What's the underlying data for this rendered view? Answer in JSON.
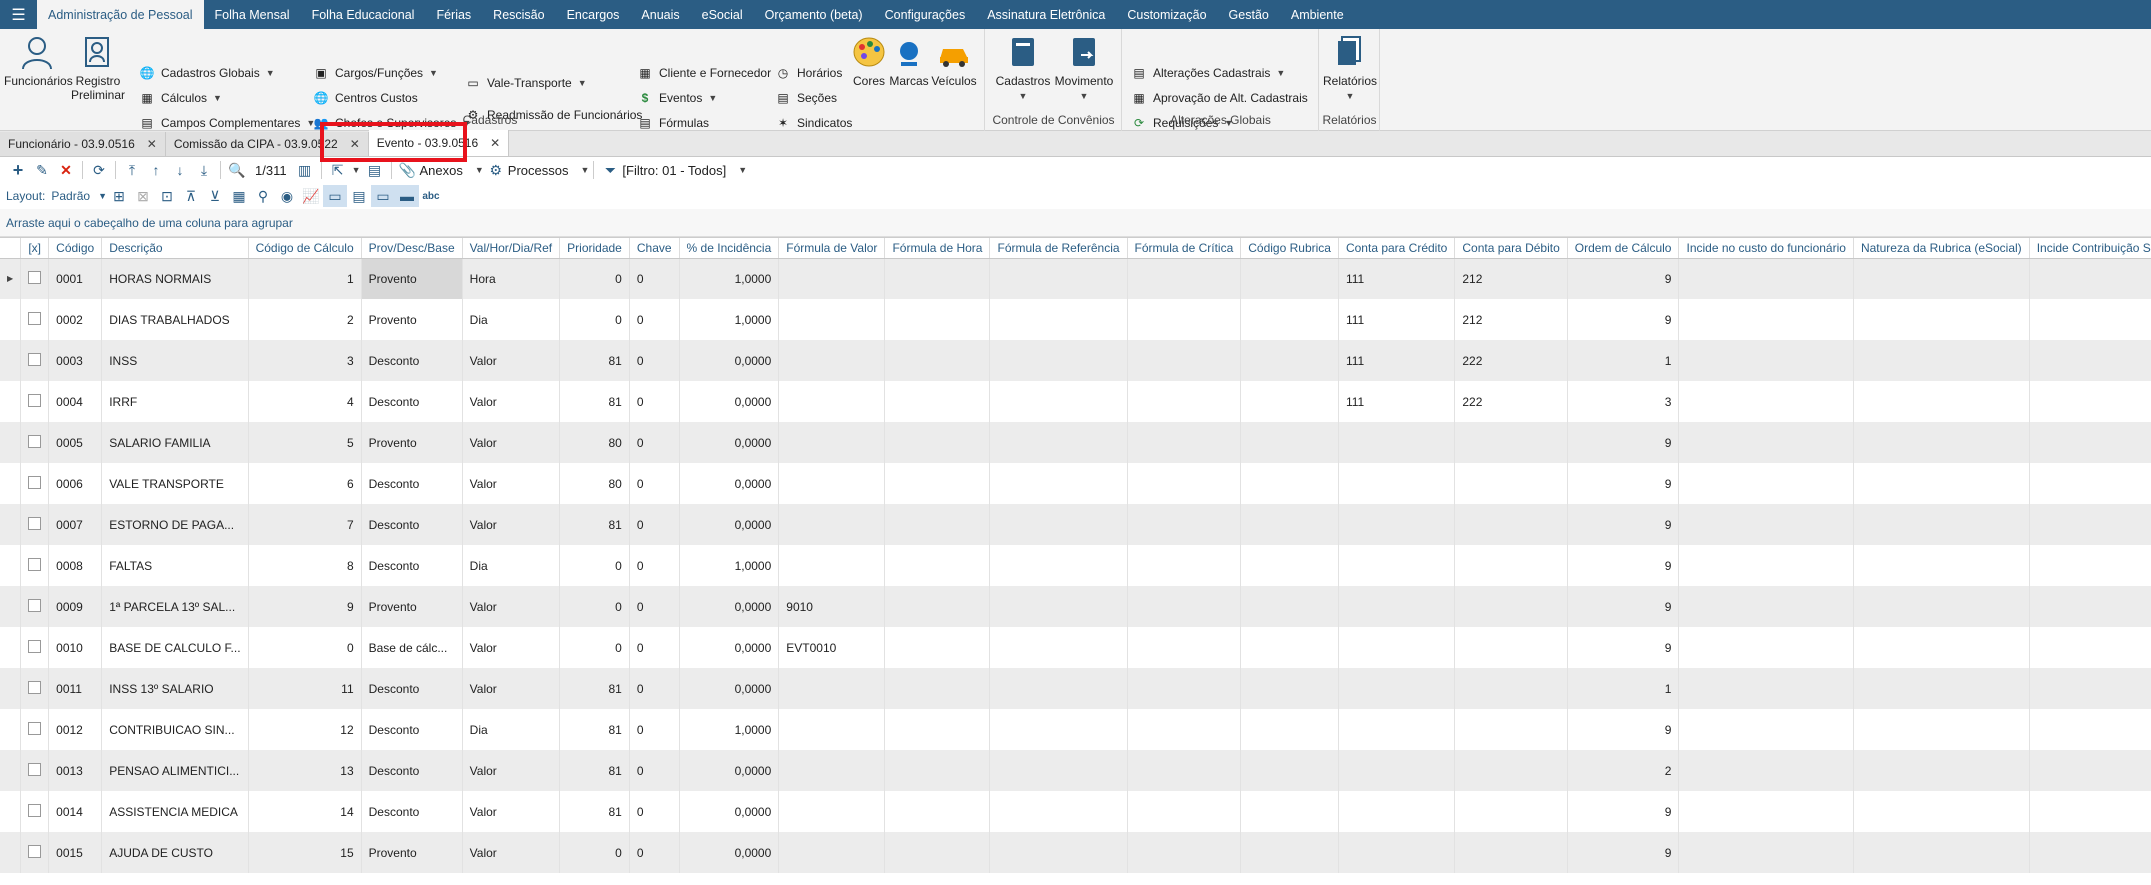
{
  "menu": {
    "items": [
      "Administração de Pessoal",
      "Folha Mensal",
      "Folha Educacional",
      "Férias",
      "Rescisão",
      "Encargos",
      "Anuais",
      "eSocial",
      "Orçamento (beta)",
      "Configurações",
      "Assinatura Eletrônica",
      "Customização",
      "Gestão",
      "Ambiente"
    ]
  },
  "ribbon": {
    "funcionarios": "Funcionários",
    "registro_l1": "Registro",
    "registro_l2": "Preliminar",
    "cadastros_globais": "Cadastros Globais",
    "calculos": "Cálculos",
    "campos_complementares": "Campos Complementares",
    "cargos_funcoes": "Cargos/Funções",
    "centros_custos": "Centros Custos",
    "chefes_supervisores": "Chefes e Supervisores",
    "vale_transporte": "Vale-Transporte",
    "readmissao": "Readmissão de Funcionários",
    "cliente_fornecedor": "Cliente e Fornecedor",
    "eventos": "Eventos",
    "formulas": "Fórmulas",
    "horarios": "Horários",
    "secoes": "Seções",
    "sindicatos": "Sindicatos",
    "cores": "Cores",
    "marcas": "Marcas",
    "veiculos": "Veículos",
    "group_cadastros": "Cadastros",
    "cadastros_btn": "Cadastros",
    "movimento_btn": "Movimento",
    "group_convenios": "Controle de Convênios",
    "alteracoes_cadastrais": "Alterações Cadastrais",
    "aprovacao": "Aprovação de Alt. Cadastrais",
    "requisicoes": "Requisições",
    "group_alteracoes": "Alterações Globais",
    "relatorios_btn": "Relatórios",
    "group_relatorios": "Relatórios"
  },
  "doctabs": [
    {
      "label": "Funcionário - 03.9.0516"
    },
    {
      "label": "Comissão da CIPA - 03.9.0522"
    },
    {
      "label": "Evento - 03.9.0516"
    }
  ],
  "toolbar": {
    "record_nav": "1/311",
    "anexos": "Anexos",
    "processos": "Processos",
    "filtro": "[Filtro: 01 - Todos]",
    "layout_label": "Layout:",
    "layout_value": "Padrão"
  },
  "grid": {
    "group_hint": "Arraste aqui o cabeçalho de uma coluna para agrupar",
    "columns": [
      "[x]",
      "Código",
      "Descrição",
      "Código de Cálculo",
      "Prov/Desc/Base",
      "Val/Hor/Dia/Ref",
      "Prioridade",
      "Chave",
      "% de Incidência",
      "Fórmula de Valor",
      "Fórmula de Hora",
      "Fórmula de Referência",
      "Fórmula de Crítica",
      "Código Rubrica",
      "Conta para Crédito",
      "Conta para Débito",
      "Ordem de Cálculo",
      "Incide no custo do funcionário",
      "Natureza da Rubrica (eSocial)",
      "Incide Contribuição Sindical"
    ],
    "rows": [
      [
        "0001",
        "HORAS NORMAIS",
        "1",
        "Provento",
        "Hora",
        "0",
        "0",
        "1,0000",
        "",
        "",
        "",
        "",
        "",
        "111",
        "212",
        "9"
      ],
      [
        "0002",
        "DIAS TRABALHADOS",
        "2",
        "Provento",
        "Dia",
        "0",
        "0",
        "1,0000",
        "",
        "",
        "",
        "",
        "",
        "111",
        "212",
        "9"
      ],
      [
        "0003",
        "INSS",
        "3",
        "Desconto",
        "Valor",
        "81",
        "0",
        "0,0000",
        "",
        "",
        "",
        "",
        "",
        "111",
        "222",
        "1"
      ],
      [
        "0004",
        "IRRF",
        "4",
        "Desconto",
        "Valor",
        "81",
        "0",
        "0,0000",
        "",
        "",
        "",
        "",
        "",
        "111",
        "222",
        "3"
      ],
      [
        "0005",
        "SALARIO FAMILIA",
        "5",
        "Provento",
        "Valor",
        "80",
        "0",
        "0,0000",
        "",
        "",
        "",
        "",
        "",
        "",
        "",
        "9"
      ],
      [
        "0006",
        "VALE TRANSPORTE",
        "6",
        "Desconto",
        "Valor",
        "80",
        "0",
        "0,0000",
        "",
        "",
        "",
        "",
        "",
        "",
        "",
        "9"
      ],
      [
        "0007",
        "ESTORNO DE PAGA...",
        "7",
        "Desconto",
        "Valor",
        "81",
        "0",
        "0,0000",
        "",
        "",
        "",
        "",
        "",
        "",
        "",
        "9"
      ],
      [
        "0008",
        "FALTAS",
        "8",
        "Desconto",
        "Dia",
        "0",
        "0",
        "1,0000",
        "",
        "",
        "",
        "",
        "",
        "",
        "",
        "9"
      ],
      [
        "0009",
        "1ª PARCELA 13º SAL...",
        "9",
        "Provento",
        "Valor",
        "0",
        "0",
        "0,0000",
        "9010",
        "",
        "",
        "",
        "",
        "",
        "",
        "9"
      ],
      [
        "0010",
        "BASE DE CALCULO F...",
        "0",
        "Base de cálc...",
        "Valor",
        "0",
        "0",
        "0,0000",
        "EVT0010",
        "",
        "",
        "",
        "",
        "",
        "",
        "9"
      ],
      [
        "0011",
        "INSS 13º SALARIO",
        "11",
        "Desconto",
        "Valor",
        "81",
        "0",
        "0,0000",
        "",
        "",
        "",
        "",
        "",
        "",
        "",
        "1"
      ],
      [
        "0012",
        "CONTRIBUICAO SIN...",
        "12",
        "Desconto",
        "Dia",
        "81",
        "0",
        "1,0000",
        "",
        "",
        "",
        "",
        "",
        "",
        "",
        "9"
      ],
      [
        "0013",
        "PENSAO ALIMENTICI...",
        "13",
        "Desconto",
        "Valor",
        "81",
        "0",
        "0,0000",
        "",
        "",
        "",
        "",
        "",
        "",
        "",
        "2"
      ],
      [
        "0014",
        "ASSISTENCIA MEDICA",
        "14",
        "Desconto",
        "Valor",
        "81",
        "0",
        "0,0000",
        "",
        "",
        "",
        "",
        "",
        "",
        "",
        "9"
      ],
      [
        "0015",
        "AJUDA DE CUSTO",
        "15",
        "Provento",
        "Valor",
        "0",
        "0",
        "0,0000",
        "",
        "",
        "",
        "",
        "",
        "",
        "",
        "9"
      ]
    ]
  }
}
